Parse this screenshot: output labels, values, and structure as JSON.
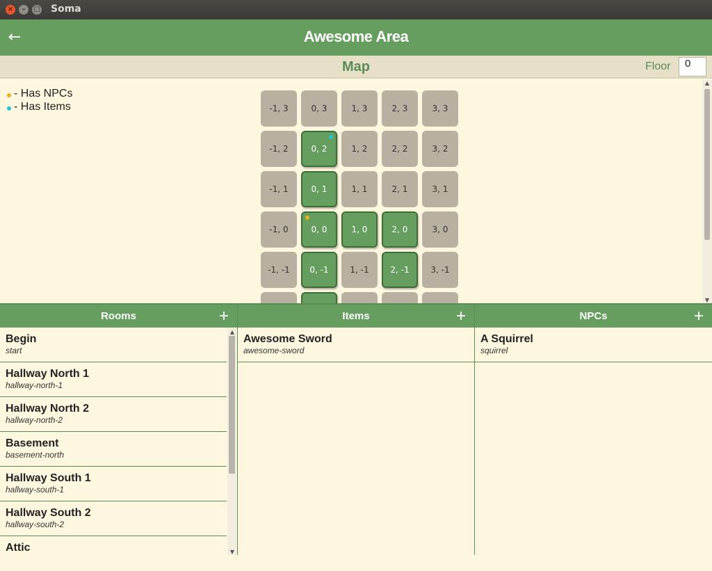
{
  "window": {
    "title": "Soma"
  },
  "header": {
    "title": "Awesome Area",
    "back_icon": "arrow-left-icon"
  },
  "map": {
    "title": "Map",
    "floor_label": "Floor",
    "floor_value": "0",
    "legend": {
      "npcs": "- Has NPCs",
      "items": "- Has Items"
    },
    "colors": {
      "npc_dot": "#e8b21a",
      "item_dot": "#21c7d6",
      "active_room": "#659e5e",
      "empty_room": "#b8b0a1"
    },
    "rows": [
      [
        "-1, 3",
        "0, 3",
        "1, 3",
        "2, 3",
        "3, 3"
      ],
      [
        "-1, 2",
        "0, 2",
        "1, 2",
        "2, 2",
        "3, 2"
      ],
      [
        "-1, 1",
        "0, 1",
        "1, 1",
        "2, 1",
        "3, 1"
      ],
      [
        "-1, 0",
        "0, 0",
        "1, 0",
        "2, 0",
        "3, 0"
      ],
      [
        "-1, -1",
        "0, -1",
        "1, -1",
        "2, -1",
        "3, -1"
      ]
    ]
  },
  "rooms": {
    "title": "Rooms",
    "add_label": "+",
    "items": [
      {
        "name": "Begin",
        "id": "start"
      },
      {
        "name": "Hallway North 1",
        "id": "hallway-north-1"
      },
      {
        "name": "Hallway North 2",
        "id": "hallway-north-2"
      },
      {
        "name": "Basement",
        "id": "basement-north"
      },
      {
        "name": "Hallway South 1",
        "id": "hallway-south-1"
      },
      {
        "name": "Hallway South 2",
        "id": "hallway-south-2"
      },
      {
        "name": "Attic",
        "id": ""
      }
    ]
  },
  "items": {
    "title": "Items",
    "add_label": "+",
    "items": [
      {
        "name": "Awesome Sword",
        "id": "awesome-sword"
      }
    ]
  },
  "npcs": {
    "title": "NPCs",
    "add_label": "+",
    "items": [
      {
        "name": "A Squirrel",
        "id": "squirrel"
      }
    ]
  }
}
